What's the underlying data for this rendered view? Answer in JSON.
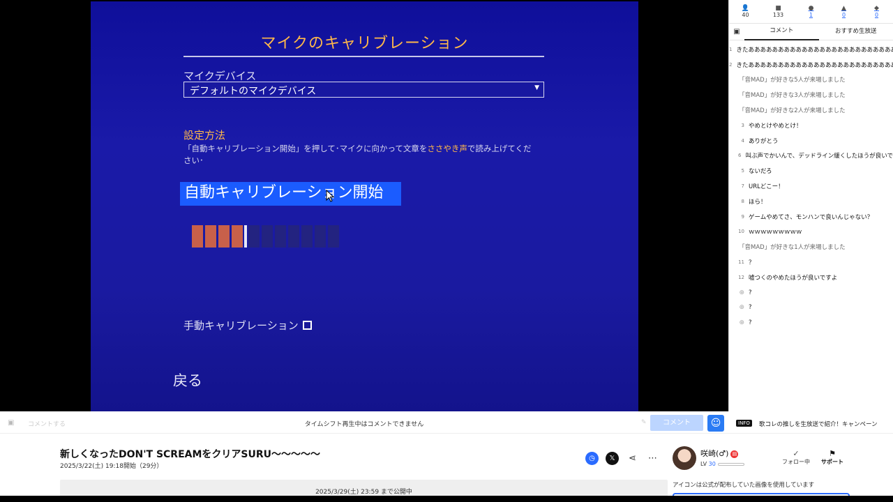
{
  "game": {
    "title": "マイクのキャリブレーション",
    "mic_device_label": "マイクデバイス",
    "mic_device_value": "デフォルトのマイクデバイス",
    "method_title": "設定方法",
    "method_desc_pre": "「自動キャリブレーション開始」を押して･マイクに向かって文章を",
    "method_desc_hl": "ささやき声",
    "method_desc_post": "で読み上げてください･",
    "auto_button": "自動キャリブレーション開始",
    "meter_level": 0.4,
    "manual_label": "手動キャリブレーション",
    "back": "戻る"
  },
  "stats": [
    {
      "icon": "viewer-icon",
      "glyph": "👤",
      "value": "40"
    },
    {
      "icon": "comment-count-icon",
      "glyph": "■",
      "value": "133"
    },
    {
      "icon": "timeshift-icon",
      "glyph": "●",
      "value": "1"
    },
    {
      "icon": "ad-icon",
      "glyph": "▲",
      "value": "0"
    },
    {
      "icon": "gift-icon",
      "glyph": "◆",
      "value": "0"
    }
  ],
  "tabs": {
    "comments": "コメント",
    "recommended": "おすすめ生放送"
  },
  "comments": [
    {
      "num": "1",
      "text": "きたあああああああああああああああああああああああああ"
    },
    {
      "num": "2",
      "text": "きたあああああああああああああああああああああああああ"
    },
    {
      "num": "",
      "text": "「音MAD」が好きな5人が来場しました",
      "type": "sys"
    },
    {
      "num": "",
      "text": "「音MAD」が好きな3人が来場しました",
      "type": "sys"
    },
    {
      "num": "",
      "text": "「音MAD」が好きな2人が来場しました",
      "type": "sys"
    },
    {
      "num": "3",
      "text": "やめとけやめとけ！"
    },
    {
      "num": "4",
      "text": "ありがとう"
    },
    {
      "num": "6",
      "text": "叫ぶ声でかいんで、デッドライン緩くしたほうが良いで"
    },
    {
      "num": "5",
      "text": "ないだろ"
    },
    {
      "num": "7",
      "text": "URLどこー！"
    },
    {
      "num": "8",
      "text": "ほら！"
    },
    {
      "num": "9",
      "text": "ゲームやめてさ、モンハンで良いんじゃない？"
    },
    {
      "num": "10",
      "text": "ｗｗｗｗｗｗｗｗｗ"
    },
    {
      "num": "",
      "text": "「音MAD」が好きな1人が来場しました",
      "type": "sys"
    },
    {
      "num": "11",
      "text": "？"
    },
    {
      "num": "12",
      "text": "嘘つくのやめたほうが良いですよ"
    },
    {
      "num": "",
      "text": "?",
      "type": "emo"
    },
    {
      "num": "",
      "text": "?",
      "type": "emo"
    },
    {
      "num": "",
      "text": "?",
      "type": "emo"
    }
  ],
  "comment_bar": {
    "placeholder": "コメントする",
    "notice": "タイムシフト再生中はコメントできません",
    "send": "コメント"
  },
  "info": {
    "badge": "INFO",
    "text": "歌コレの推しを生放送で紹介！キャンペーン"
  },
  "program": {
    "title": "新しくなったDON'T SCREAMをクリアSURU〜〜〜〜〜",
    "date": "2025/3/22(土) 19:18開始（29分）",
    "public_until": "2025/3/29(土) 23:59 まで公開中"
  },
  "user": {
    "name": "咲崎(♂)",
    "level_prefix": "LV",
    "level": "30",
    "follow": "フォロー中",
    "support": "サポート",
    "avatar_note": "アイコンは公式が配布していた画像を使用しています"
  }
}
